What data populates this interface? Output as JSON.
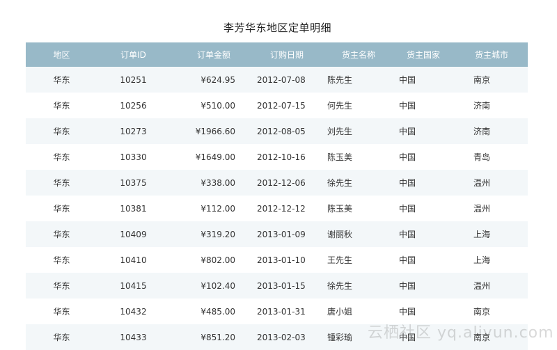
{
  "report": {
    "title": "李芳华东地区定单明细"
  },
  "table": {
    "headers": [
      "地区",
      "订单ID",
      "订单金额",
      "订购日期",
      "货主名称",
      "货主国家",
      "货主城市"
    ],
    "rows": [
      [
        "华东",
        "10251",
        "¥624.95",
        "2012-07-08",
        "陈先生",
        "中国",
        "南京"
      ],
      [
        "华东",
        "10256",
        "¥510.00",
        "2012-07-15",
        "何先生",
        "中国",
        "济南"
      ],
      [
        "华东",
        "10273",
        "¥1966.60",
        "2012-08-05",
        "刘先生",
        "中国",
        "济南"
      ],
      [
        "华东",
        "10330",
        "¥1649.00",
        "2012-10-16",
        "陈玉美",
        "中国",
        "青岛"
      ],
      [
        "华东",
        "10375",
        "¥338.00",
        "2012-12-06",
        "徐先生",
        "中国",
        "温州"
      ],
      [
        "华东",
        "10381",
        "¥112.00",
        "2012-12-12",
        "陈玉美",
        "中国",
        "温州"
      ],
      [
        "华东",
        "10409",
        "¥319.20",
        "2013-01-09",
        "谢丽秋",
        "中国",
        "上海"
      ],
      [
        "华东",
        "10410",
        "¥802.00",
        "2013-01-10",
        "王先生",
        "中国",
        "上海"
      ],
      [
        "华东",
        "10415",
        "¥102.40",
        "2013-01-15",
        "徐先生",
        "中国",
        "温州"
      ],
      [
        "华东",
        "10432",
        "¥485.00",
        "2013-01-31",
        "唐小姐",
        "中国",
        "南京"
      ],
      [
        "华东",
        "10433",
        "¥851.20",
        "2013-02-03",
        "锺彩瑜",
        "中国",
        "南京"
      ]
    ]
  },
  "watermark": {
    "text": "云栖社区 yq.aliyun.com"
  }
}
